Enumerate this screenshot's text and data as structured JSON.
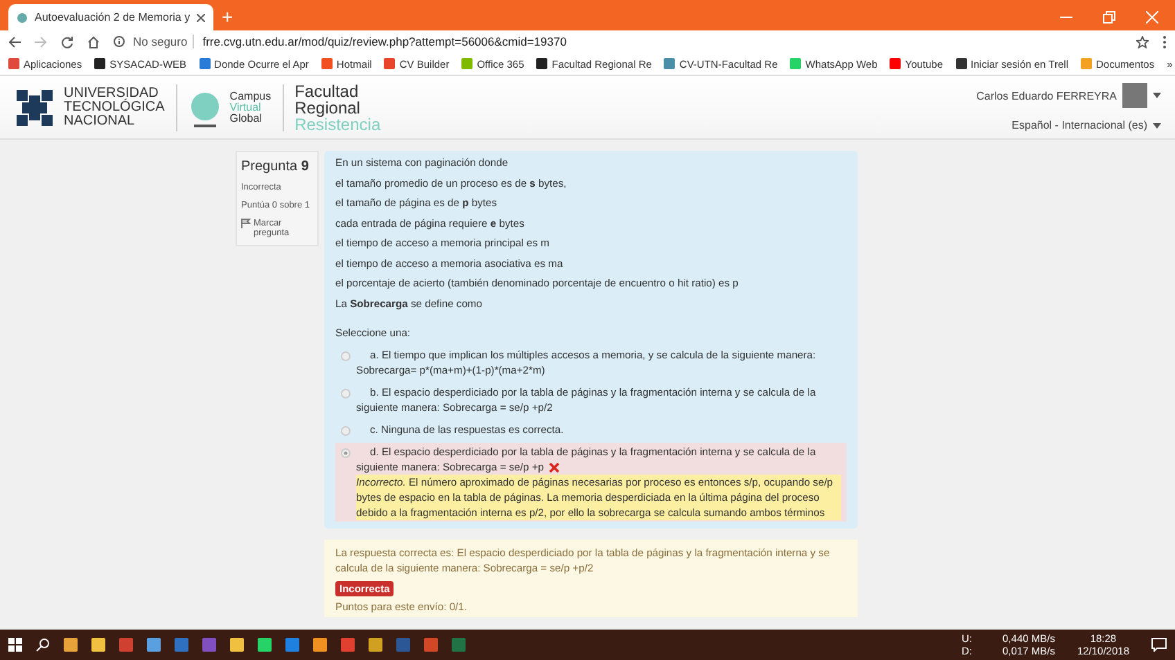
{
  "browser": {
    "tab_title": "Autoevaluación 2 de Memoria y",
    "new_tab": "+",
    "security": "No seguro",
    "url": "frre.cvg.utn.edu.ar/mod/quiz/review.php?attempt=56006&cmid=19370",
    "bookmarks": [
      {
        "label": "Aplicaciones",
        "color": "#e04a3a"
      },
      {
        "label": "SYSACAD-WEB",
        "color": "#222222"
      },
      {
        "label": "Donde Ocurre el Apr",
        "color": "#2a7bd8"
      },
      {
        "label": "Hotmail",
        "color": "#f25022"
      },
      {
        "label": "CV Builder",
        "color": "#e8452a"
      },
      {
        "label": "Office 365",
        "color": "#7fba00"
      },
      {
        "label": "Facultad Regional Re",
        "color": "#222222"
      },
      {
        "label": "CV-UTN-Facultad Re",
        "color": "#4a8fa8"
      },
      {
        "label": "WhatsApp Web",
        "color": "#25d366"
      },
      {
        "label": "Youtube",
        "color": "#ff0000"
      },
      {
        "label": "Iniciar sesión en Trell",
        "color": "#333333"
      },
      {
        "label": "Documentos",
        "color": "#f4a020"
      }
    ],
    "more": "»"
  },
  "site": {
    "utn_logo": [
      "UNIVERSIDAD",
      "TECNOLÓGICA",
      "NACIONAL"
    ],
    "campus_logo": [
      "Campus",
      "Virtual",
      "Global"
    ],
    "faculty_logo": [
      "Facultad",
      "Regional",
      "Resistencia"
    ],
    "user": "Carlos Eduardo FERREYRA",
    "language": "Español - Internacional (es)"
  },
  "question": {
    "label": "Pregunta",
    "number": "9",
    "status": "Incorrecta",
    "score": "Puntúa 0 sobre 1",
    "flag": "Marcar pregunta",
    "prompt": [
      "En un sistema con paginación donde",
      "el tamaño promedio de un proceso es de **s** bytes,",
      "el tamaño de página es de **p** bytes",
      "cada entrada de página requiere **e** bytes",
      "el tiempo de acceso a memoria principal es m",
      "el tiempo de acceso a memoria asociativa es ma",
      "el porcentaje de acierto (también denominado porcentaje de encuentro o hit ratio) es p",
      "La **Sobrecarga** se define como"
    ],
    "select_label": "Seleccione una:",
    "options": [
      {
        "text": "a. El tiempo que implican los múltiples accesos a memoria, y se calcula de la siguiente manera: Sobrecarga= p*(ma+m)+(1-p)*(ma+2*m)",
        "selected": false
      },
      {
        "text": "b. El espacio desperdiciado por la tabla de páginas y la fragmentación interna y se calcula de la siguiente manera: Sobrecarga = se/p +p/2",
        "selected": false
      },
      {
        "text": "c. Ninguna de las respuestas es correcta.",
        "selected": false
      },
      {
        "text": "d. El espacio desperdiciado por la tabla de páginas y la fragmentación interna y se calcula de la siguiente manera: Sobrecarga = se/p +p",
        "selected": true,
        "feedback": "*Incorrecto.* El número aproximado de páginas necesarias por proceso es entonces s/p, ocupando se/p bytes de espacio en la tabla de páginas. La memoria desperdiciada en la última página del proceso debido a la fragmentación interna es p/2, por ello la sobrecarga se calcula sumando ambos términos"
      }
    ],
    "correct_answer": "La respuesta correcta es: El espacio desperdiciado por la tabla de páginas y la fragmentación interna y se calcula de la siguiente manera: Sobrecarga = se/p +p/2",
    "badge": "Incorrecta",
    "points": "Puntos para este envío: 0/1."
  },
  "taskbar": {
    "apps": [
      {
        "color": "#e8a23a"
      },
      {
        "color": "#f0c040"
      },
      {
        "color": "#d04030"
      },
      {
        "color": "#5aa0e0"
      },
      {
        "color": "#3070c0"
      },
      {
        "color": "#8050c0"
      },
      {
        "color": "#f0c040"
      },
      {
        "color": "#25d366"
      },
      {
        "color": "#2080e0"
      },
      {
        "color": "#f09020"
      },
      {
        "color": "#e04030"
      },
      {
        "color": "#d0a020"
      },
      {
        "color": "#2b5797"
      },
      {
        "color": "#d24726"
      },
      {
        "color": "#217346"
      }
    ],
    "upload_label": "U:",
    "upload": "0,440 MB/s",
    "download_label": "D:",
    "download": "0,017 MB/s",
    "time": "18:28",
    "date": "12/10/2018"
  }
}
